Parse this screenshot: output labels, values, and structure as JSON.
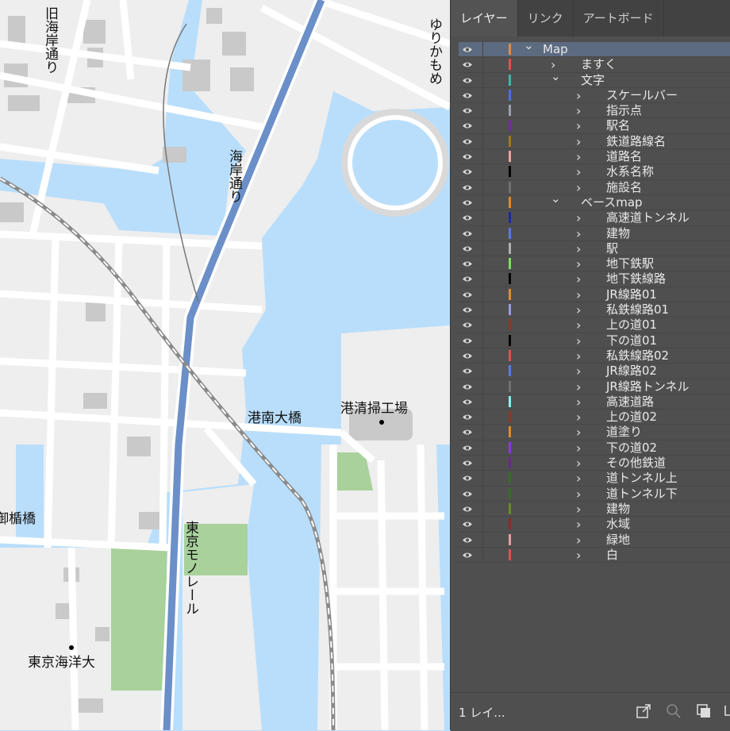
{
  "panel": {
    "tabs": [
      {
        "label": "レイヤー",
        "active": true
      },
      {
        "label": "リンク",
        "active": false
      },
      {
        "label": "アートボード",
        "active": false
      }
    ],
    "layers": [
      {
        "name": "Map",
        "level": 0,
        "expanded": true,
        "color": "#e08a4a",
        "selected": true
      },
      {
        "name": "ますく",
        "level": 1,
        "expanded": false,
        "color": "#e05050"
      },
      {
        "name": "文字",
        "level": 1,
        "expanded": true,
        "color": "#3fb7a9"
      },
      {
        "name": "スケールバー",
        "level": 2,
        "expanded": false,
        "color": "#4f6fe8"
      },
      {
        "name": "指示点",
        "level": 2,
        "expanded": false,
        "color": "#9aa0b0"
      },
      {
        "name": "駅名",
        "level": 2,
        "expanded": false,
        "color": "#7a2aa0"
      },
      {
        "name": "鉄道路線名",
        "level": 2,
        "expanded": false,
        "color": "#a07a20"
      },
      {
        "name": "道路名",
        "level": 2,
        "expanded": false,
        "color": "#f0a0a0"
      },
      {
        "name": "水系名称",
        "level": 2,
        "expanded": false,
        "color": "#000000"
      },
      {
        "name": "施設名",
        "level": 2,
        "expanded": false,
        "color": "#707070"
      },
      {
        "name": "ベースmap",
        "level": 1,
        "expanded": true,
        "color": "#e08a2a"
      },
      {
        "name": "高速道トンネル",
        "level": 2,
        "expanded": false,
        "color": "#1a2aa0"
      },
      {
        "name": "建物",
        "level": 2,
        "expanded": false,
        "color": "#5a7ae0"
      },
      {
        "name": "駅",
        "level": 2,
        "expanded": false,
        "color": "#b0b0b0"
      },
      {
        "name": "地下鉄駅",
        "level": 2,
        "expanded": false,
        "color": "#7ae05a"
      },
      {
        "name": "地下鉄線路",
        "level": 2,
        "expanded": false,
        "color": "#000000"
      },
      {
        "name": "JR線路01",
        "level": 2,
        "expanded": false,
        "color": "#e08a3a"
      },
      {
        "name": "私鉄線路01",
        "level": 2,
        "expanded": false,
        "color": "#9a9ae0"
      },
      {
        "name": "上の道01",
        "level": 2,
        "expanded": false,
        "color": "#8a3a2a"
      },
      {
        "name": "下の道01",
        "level": 2,
        "expanded": false,
        "color": "#000000"
      },
      {
        "name": "私鉄線路02",
        "level": 2,
        "expanded": false,
        "color": "#e05050"
      },
      {
        "name": "JR線路02",
        "level": 2,
        "expanded": false,
        "color": "#5a7ae0"
      },
      {
        "name": "JR線路トンネル",
        "level": 2,
        "expanded": false,
        "color": "#707070"
      },
      {
        "name": "高速道路",
        "level": 2,
        "expanded": false,
        "color": "#8af0f0"
      },
      {
        "name": "上の道02",
        "level": 2,
        "expanded": false,
        "color": "#8a3a2a"
      },
      {
        "name": "道塗り",
        "level": 2,
        "expanded": false,
        "color": "#e08a2a"
      },
      {
        "name": "下の道02",
        "level": 2,
        "expanded": false,
        "color": "#8a3ae0"
      },
      {
        "name": "その他鉄道",
        "level": 2,
        "expanded": false,
        "color": "#6a2a8a"
      },
      {
        "name": "道トンネル上",
        "level": 2,
        "expanded": false,
        "color": "#3a6a2a"
      },
      {
        "name": "道トンネル下",
        "level": 2,
        "expanded": false,
        "color": "#3a6a2a"
      },
      {
        "name": "建物",
        "level": 2,
        "expanded": false,
        "color": "#6a8a2a"
      },
      {
        "name": "水域",
        "level": 2,
        "expanded": false,
        "color": "#8a2a2a"
      },
      {
        "name": "緑地",
        "level": 2,
        "expanded": false,
        "color": "#e0a0a0"
      },
      {
        "name": "白",
        "level": 2,
        "expanded": false,
        "color": "#e05050"
      }
    ],
    "footer": {
      "count_label": "1 レイ..."
    }
  },
  "map": {
    "labels": {
      "kyu_kaigan": "旧海岸通り",
      "yurikamome": "ゆりかもめ",
      "kaigan": "海岸通り",
      "konan_bridge": "港南大橋",
      "seiso_kojo": "港清掃工場",
      "mitate_bridge": "御楯橋",
      "monorail": "東京モノレール",
      "kaiyo_univ": "東京海洋大"
    },
    "colors": {
      "water": "#b9defb",
      "land": "#eeeeee",
      "road": "#ffffff",
      "highway": "#6b8fc8",
      "green": "#a8d19c",
      "building": "#cccccc"
    }
  }
}
